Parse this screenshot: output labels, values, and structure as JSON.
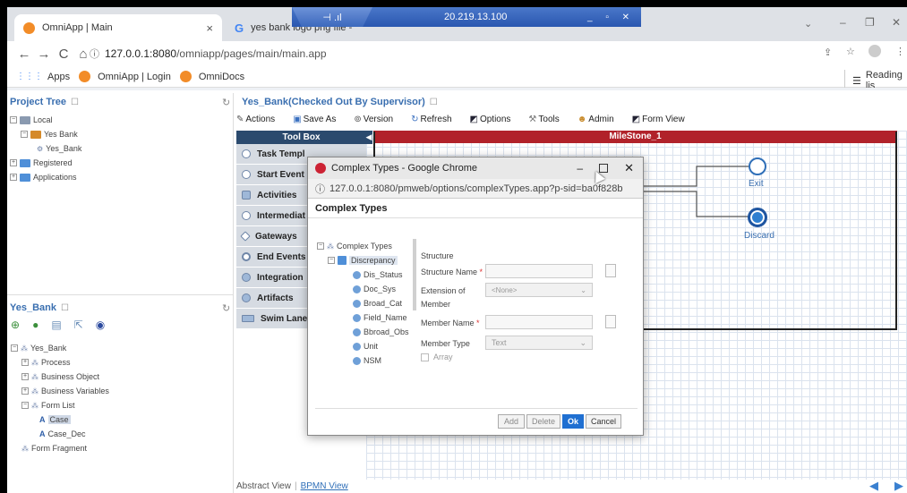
{
  "browser": {
    "tab1_title": "OmniApp | Main",
    "tab1_close": "×",
    "tab2_title": "yes bank logo png file -",
    "remote_ip": "20.219.13.100",
    "url_host": "127.0.0.1:8080",
    "url_path": "/omniapp/pages/main/main.app",
    "bookmarks": [
      "Apps",
      "OmniApp | Login",
      "OmniDocs"
    ],
    "reading_list": "Reading lis"
  },
  "project_tree": {
    "title": "Project Tree",
    "items": [
      "Local",
      "Yes Bank",
      "Yes_Bank",
      "Registered",
      "Applications"
    ]
  },
  "yesbank_panel": {
    "title": "Yes_Bank",
    "items": [
      "Yes_Bank",
      "Process",
      "Business Object",
      "Business Variables",
      "Form List",
      "Case",
      "Case_Dec",
      "Form Fragment"
    ]
  },
  "editor": {
    "title": "Yes_Bank(Checked Out By Supervisor)",
    "toolbar": [
      "Actions",
      "Save As",
      "Version",
      "Refresh",
      "Options",
      "Tools",
      "Admin",
      "Form View"
    ]
  },
  "toolbox": {
    "title": "Tool Box",
    "items": [
      "Task Templ",
      "Start Event",
      "Activities",
      "Intermediat",
      "Gateways",
      "End Events",
      "Integration",
      "Artifacts",
      "Swim Lane"
    ]
  },
  "canvas": {
    "milestone": "MileStone_1",
    "nodes": [
      "Exit",
      "Discard"
    ],
    "views": [
      "Abstract View",
      "BPMN View"
    ]
  },
  "dialog": {
    "window_title": "Complex Types - Google Chrome",
    "url": "127.0.0.1:8080/pmweb/options/complexTypes.app?p-sid=ba0f828b",
    "heading": "Complex Types",
    "tree_root": "Complex Types",
    "tree_group": "Discrepancy",
    "tree_items": [
      "Dis_Status",
      "Doc_Sys",
      "Broad_Cat",
      "Field_Name",
      "Bbroad_Obs",
      "Unit",
      "NSM"
    ],
    "structure_label": "Structure",
    "structure_name_label": "Structure Name",
    "extension_label_1": "Extension of",
    "extension_label_2": "Member",
    "extension_value": "<None>",
    "member_name_label": "Member Name",
    "member_type_label": "Member Type",
    "member_type_value": "Text",
    "array_label": "Array",
    "required_mark": "*",
    "buttons": {
      "add": "Add",
      "delete": "Delete",
      "ok": "Ok",
      "cancel": "Cancel"
    }
  }
}
